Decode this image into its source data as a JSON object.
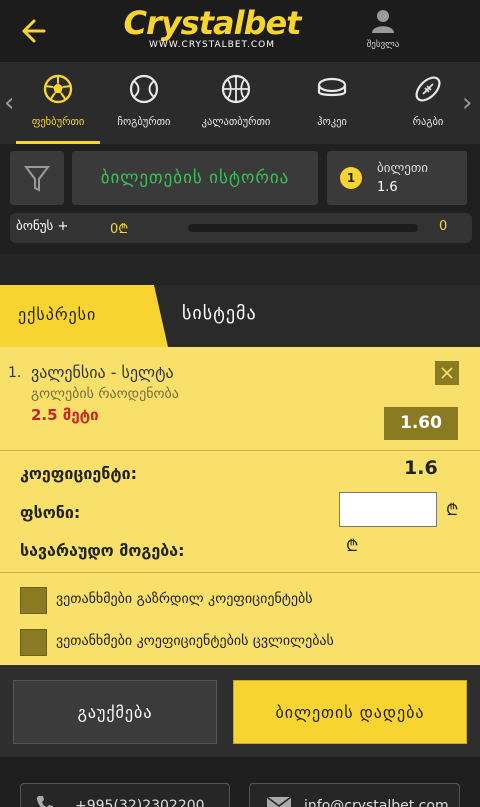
{
  "header": {
    "logo_text": "Crystalbet",
    "logo_url_text": "WWW.CRYSTALBET.COM",
    "login_label": "შესვლა"
  },
  "sports": [
    {
      "label": "ფეხბურთი",
      "icon": "soccer-ball-icon",
      "active": true
    },
    {
      "label": "ჩოგბურთი",
      "icon": "tennis-ball-icon",
      "active": false
    },
    {
      "label": "კალათბურთი",
      "icon": "basketball-icon",
      "active": false
    },
    {
      "label": "ჰოკეი",
      "icon": "hockey-puck-icon",
      "active": false
    },
    {
      "label": "რაგბი",
      "icon": "rugby-ball-icon",
      "active": false
    }
  ],
  "filter": {
    "history_label": "ბილეთების ისტორია",
    "tickets_count": "1",
    "tickets_label": "ბილეთი",
    "tickets_odds": "1.6"
  },
  "bonus": {
    "label": "ბონუს +",
    "left_value": "0₾",
    "right_value": "0",
    "progress": 0
  },
  "tabs": {
    "express": "ექსპრესი",
    "system": "სისტემა"
  },
  "bet": {
    "number": "1.",
    "event": "ვალენსია - სელტა",
    "market": "გოლების რაოდენობა",
    "selection": "2.5 მეტი",
    "odds": "1.60"
  },
  "summary": {
    "coef_label": "კოეფიციენტი:",
    "coef_value": "1.6",
    "stake_label": "ფსონი:",
    "stake_value": "",
    "win_label": "სავარაუდო მოგება:",
    "currency": "₾"
  },
  "options": [
    {
      "label": "ვეთანხმები გაზრდილ კოეფიციენტებს",
      "checked": false
    },
    {
      "label": "ვეთანხმები კოეფიციენტების ცვლილებას",
      "checked": false
    }
  ],
  "actions": {
    "cancel": "გაუქმება",
    "place": "ბილეთის დადება"
  },
  "footer": {
    "phone": "+995(32)2302200",
    "email": "info@crystalbet.com"
  },
  "colors": {
    "accent": "#f7d42f",
    "panel": "#f8e06a",
    "history_text": "#3bc15a",
    "selection_text": "#c72424"
  }
}
